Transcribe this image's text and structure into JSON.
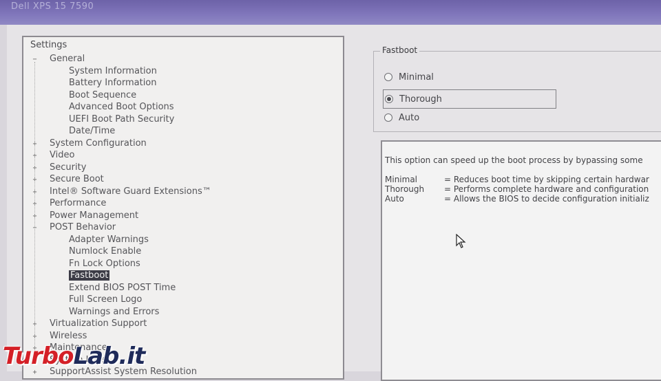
{
  "window": {
    "title": "Dell XPS 15 7590"
  },
  "settings": {
    "title": "Settings",
    "tree": [
      {
        "label": "General",
        "level": 0,
        "expander": "−"
      },
      {
        "label": "System Information",
        "level": 1
      },
      {
        "label": "Battery Information",
        "level": 1
      },
      {
        "label": "Boot Sequence",
        "level": 1
      },
      {
        "label": "Advanced Boot Options",
        "level": 1
      },
      {
        "label": "UEFI Boot Path Security",
        "level": 1
      },
      {
        "label": "Date/Time",
        "level": 1
      },
      {
        "label": "System Configuration",
        "level": 0,
        "expander": "+"
      },
      {
        "label": "Video",
        "level": 0,
        "expander": "+"
      },
      {
        "label": "Security",
        "level": 0,
        "expander": "+"
      },
      {
        "label": "Secure Boot",
        "level": 0,
        "expander": "+"
      },
      {
        "label": "Intel® Software Guard Extensions™",
        "level": 0,
        "expander": "+"
      },
      {
        "label": "Performance",
        "level": 0,
        "expander": "+"
      },
      {
        "label": "Power Management",
        "level": 0,
        "expander": "+"
      },
      {
        "label": "POST Behavior",
        "level": 0,
        "expander": "−"
      },
      {
        "label": "Adapter Warnings",
        "level": 1
      },
      {
        "label": "Numlock Enable",
        "level": 1
      },
      {
        "label": "Fn Lock Options",
        "level": 1
      },
      {
        "label": "Fastboot",
        "level": 1,
        "selected": true
      },
      {
        "label": "Extend BIOS POST Time",
        "level": 1
      },
      {
        "label": "Full Screen Logo",
        "level": 1
      },
      {
        "label": "Warnings and Errors",
        "level": 1
      },
      {
        "label": "Virtualization Support",
        "level": 0,
        "expander": "+"
      },
      {
        "label": "Wireless",
        "level": 0,
        "expander": "+"
      },
      {
        "label": "Maintenance",
        "level": 0,
        "expander": "+"
      },
      {
        "label": "System Logs",
        "level": 0,
        "expander": "+"
      },
      {
        "label": "SupportAssist System Resolution",
        "level": 0,
        "expander": "+"
      }
    ]
  },
  "fastboot": {
    "group_label": "Fastboot",
    "options": [
      {
        "label": "Minimal",
        "checked": false
      },
      {
        "label": "Thorough",
        "checked": true
      },
      {
        "label": "Auto",
        "checked": false
      }
    ],
    "description": "This option can speed up the boot process by bypassing some",
    "option_descriptions": [
      {
        "key": "Minimal",
        "text": "= Reduces boot time by skipping certain hardwar"
      },
      {
        "key": "Thorough",
        "text": "= Performs complete hardware and configuration"
      },
      {
        "key": "Auto",
        "text": "= Allows the BIOS to decide configuration initializ"
      }
    ]
  },
  "watermark": {
    "part1": "Turbo",
    "part2": "Lab.it"
  },
  "colors": {
    "titlebar": "#7a70b6",
    "selection": "#3c3c46",
    "watermark_red": "#d42027"
  }
}
